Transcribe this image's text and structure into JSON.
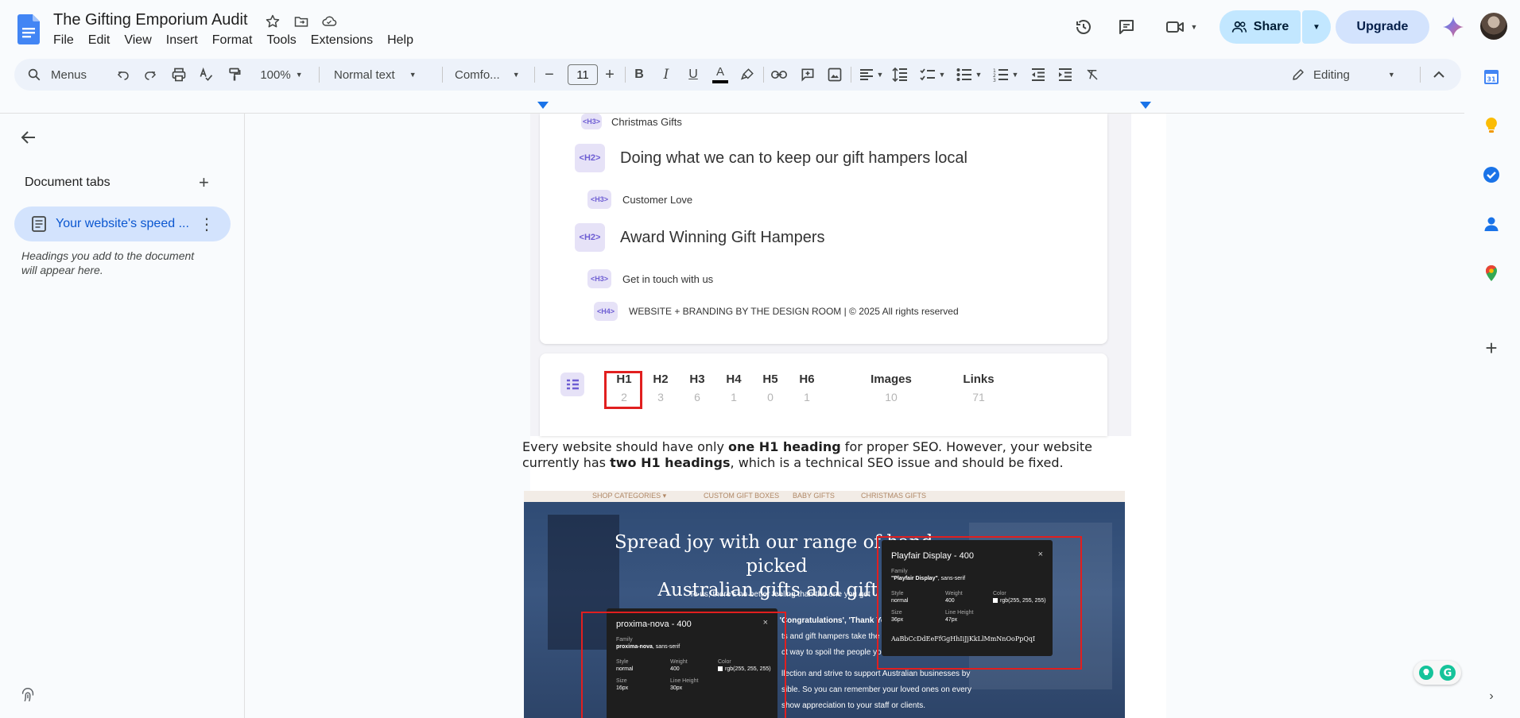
{
  "app": {
    "title": "The Gifting Emporium Audit",
    "menu": [
      "File",
      "Edit",
      "View",
      "Insert",
      "Format",
      "Tools",
      "Extensions",
      "Help"
    ],
    "share_label": "Share",
    "upgrade_label": "Upgrade"
  },
  "toolbar": {
    "search_label": "Menus",
    "zoom": "100%",
    "style": "Normal text",
    "font": "Comfo...",
    "font_size": "11",
    "mode": "Editing"
  },
  "sidebar": {
    "section_title": "Document tabs",
    "active_tab": "Your website's speed ...",
    "hint": "Headings you add to the document will appear here."
  },
  "document": {
    "outline": [
      {
        "level": "<H3>",
        "text": "Christmas Gifts"
      },
      {
        "level": "<H2>",
        "text": "Doing what we can to keep our gift hampers local"
      },
      {
        "level": "<H3>",
        "text": "Customer Love"
      },
      {
        "level": "<H2>",
        "text": "Award Winning Gift Hampers"
      },
      {
        "level": "<H3>",
        "text": "Get in touch with us"
      },
      {
        "level": "<H4>",
        "text": "WEBSITE + BRANDING BY THE DESIGN ROOM | © 2025 All rights reserved"
      }
    ],
    "stats": [
      {
        "label": "H1",
        "value": "2"
      },
      {
        "label": "H2",
        "value": "3"
      },
      {
        "label": "H3",
        "value": "6"
      },
      {
        "label": "H4",
        "value": "1"
      },
      {
        "label": "H5",
        "value": "0"
      },
      {
        "label": "H6",
        "value": "1"
      },
      {
        "label": "Images",
        "value": "10"
      },
      {
        "label": "Links",
        "value": "71"
      }
    ],
    "paragraph": {
      "p1": "Every website should have only ",
      "b1": "one H1 heading",
      "p2": " for proper SEO. However, your website currently has ",
      "b2": "two H1 headings",
      "p3": ", which is a technical SEO issue and should be fixed."
    },
    "hero": {
      "nav": [
        "SHOP CATEGORIES ▾",
        "CUSTOM GIFT BOXES",
        "BABY GIFTS",
        "CHRISTMAS GIFTS"
      ],
      "title_line1": "Spread joy with our range of hand-picked",
      "title_line2": "Australian gifts and gift h",
      "line_a": "To us, there's no better feeling than the one you get",
      "line_b": "Whether you need to tell someone 'Congratulations', 'Thank Yo",
      "line_c": "ts and gift hampers take the c",
      "line_d": "ct way to spoil the people yo",
      "line_e": "llection and strive to support Australian businesses by",
      "line_f": "sible. So you can remember your loved ones on every",
      "line_g": "show appreciation to your staff or clients."
    },
    "inspector_right": {
      "title": "Playfair Display - 400",
      "close": "×",
      "family_label": "Family",
      "family_name": "\"Playfair Display\"",
      "family_rest": ", sans-serif",
      "style_label": "Style",
      "style_value": "normal",
      "weight_label": "Weight",
      "weight_value": "400",
      "color_label": "Color",
      "color_value": "rgb(255, 255, 255)",
      "size_label": "Size",
      "size_value": "36px",
      "lh_label": "Line Height",
      "lh_value": "47px",
      "sample": "AaBbCcDdEeFfGgHhIiJjKkLlMmNnOoPpQqI"
    },
    "inspector_left": {
      "title": "proxima-nova - 400",
      "close": "×",
      "family_label": "Family",
      "family_name": "proxima-nova",
      "family_rest": ", sans-serif",
      "style_label": "Style",
      "style_value": "normal",
      "weight_label": "Weight",
      "weight_value": "400",
      "color_label": "Color",
      "color_value": "rgb(255, 255, 255)",
      "size_label": "Size",
      "size_value": "16px",
      "lh_label": "Line Height",
      "lh_value": "30px"
    }
  },
  "colors": {
    "accent": "#0b57d0",
    "share_bg": "#c2e7ff",
    "highlight_red": "#e11f1f"
  }
}
